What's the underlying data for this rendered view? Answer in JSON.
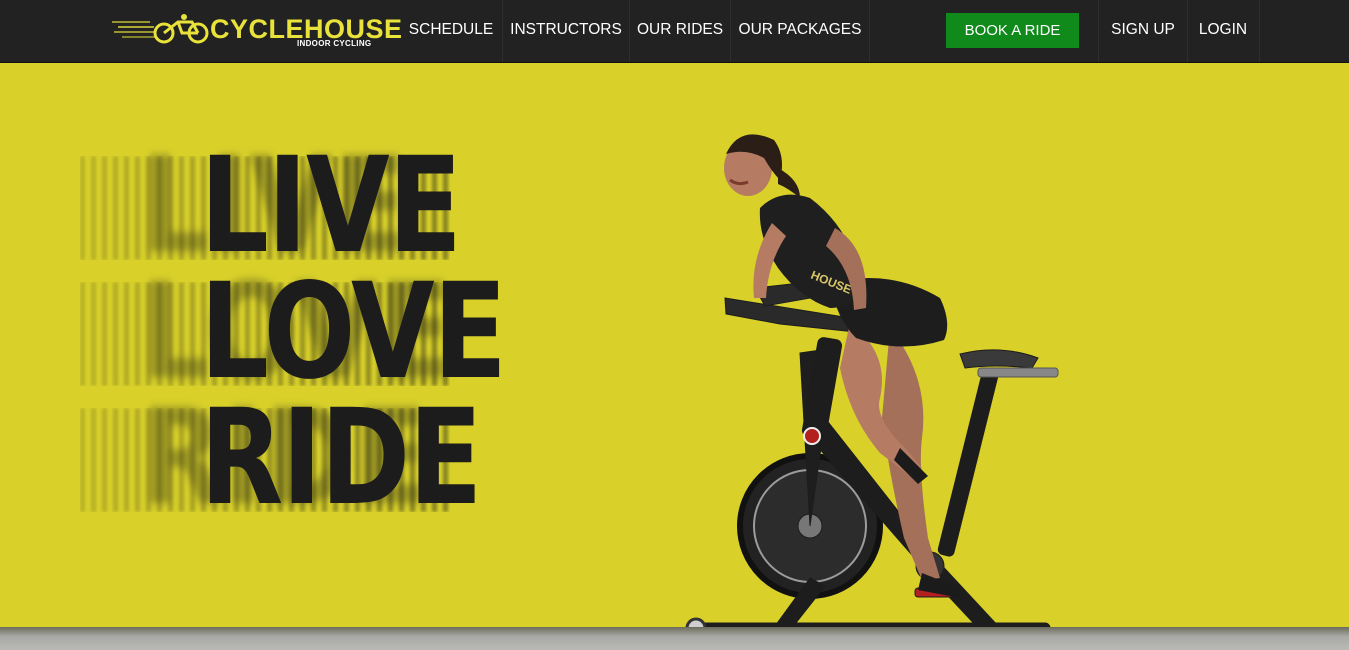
{
  "brand": {
    "name": "CYCLEHOUSE",
    "tagline": "INDOOR CYCLING",
    "accent": "#e8e23a"
  },
  "nav": {
    "items": [
      {
        "label": "SCHEDULE"
      },
      {
        "label": "INSTRUCTORS"
      },
      {
        "label": "OUR RIDES"
      },
      {
        "label": "OUR PACKAGES"
      }
    ],
    "book_label": "BOOK A RIDE",
    "signup_label": "SIGN UP",
    "login_label": "LOGIN",
    "book_color": "#0f8a1b",
    "background": "#222222"
  },
  "hero": {
    "lines": [
      "LIVE",
      "LOVE",
      "RIDE"
    ],
    "background": "#d9d12a",
    "jersey_text": "HOUSE"
  }
}
